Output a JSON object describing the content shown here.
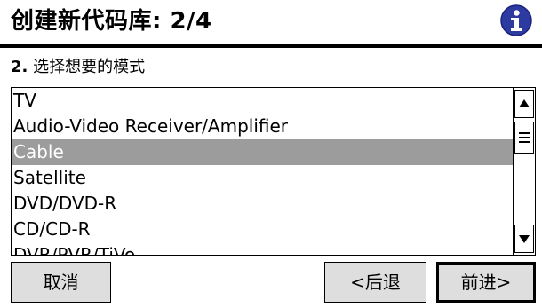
{
  "header": {
    "title": "创建新代码库: 2/4",
    "info_icon": "info-icon"
  },
  "step": {
    "number": "2.",
    "text": "选择想要的模式"
  },
  "list": {
    "items": [
      "TV",
      "Audio-Video Receiver/Amplifier",
      "Cable",
      "Satellite",
      "DVD/DVD-R",
      "CD/CD-R",
      "DVR/PVR/TiVo"
    ],
    "selected": "Cable"
  },
  "buttons": {
    "cancel": "取消",
    "back": "<后退",
    "next": "前进>"
  },
  "colors": {
    "selection": "#9c9c9c",
    "button_face": "#dedede",
    "info_icon": "#2d3aa0"
  }
}
